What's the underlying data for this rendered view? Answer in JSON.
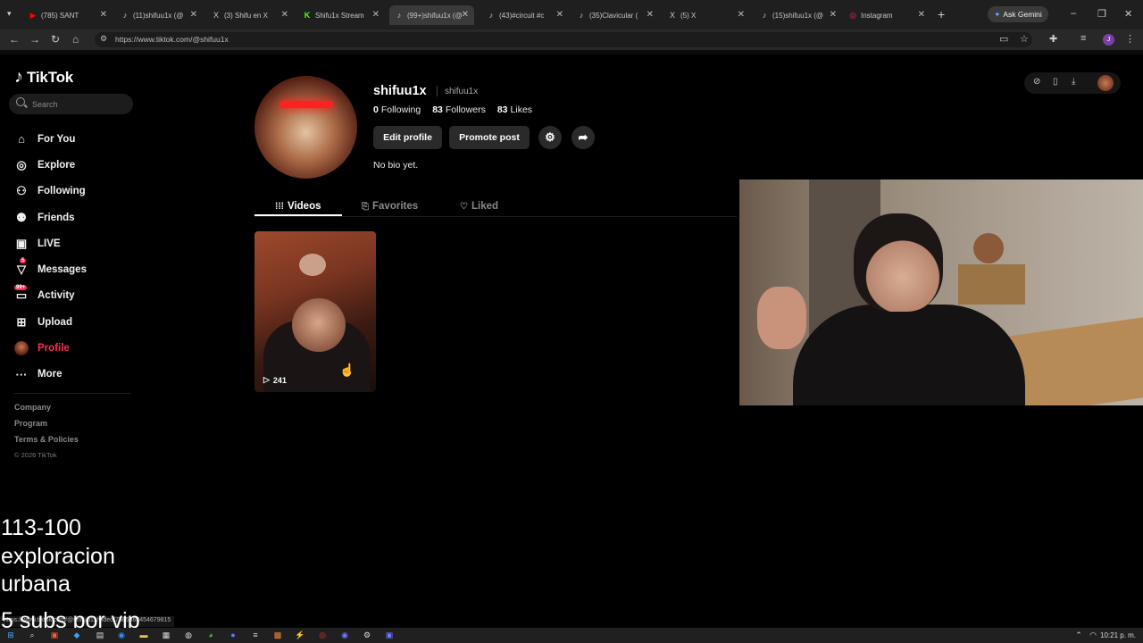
{
  "browser": {
    "tabs": [
      {
        "label": "(785) SANT",
        "icon": "youtube-icon",
        "color": "#ff0000"
      },
      {
        "label": "(11)shifuu1x (@",
        "icon": "tiktok-icon",
        "color": "#ffffff"
      },
      {
        "label": "(3) Shifu en X",
        "icon": "x-icon",
        "color": "#ffffff"
      },
      {
        "label": "Shifu1x Stream",
        "icon": "kick-icon",
        "color": "#53fc18"
      },
      {
        "label": "(99+)shifuu1x (@",
        "icon": "tiktok-icon",
        "color": "#ffffff",
        "active": true
      },
      {
        "label": "(43)#circuit #c",
        "icon": "tiktok-icon",
        "color": "#ffffff"
      },
      {
        "label": "(35)Clavicular (",
        "icon": "tiktok-icon",
        "color": "#ffffff"
      },
      {
        "label": "(5) X",
        "icon": "x-icon",
        "color": "#ffffff"
      },
      {
        "label": "(15)shifuu1x (@",
        "icon": "tiktok-icon",
        "color": "#ffffff"
      },
      {
        "label": "Instagram",
        "icon": "instagram-icon",
        "color": "#e1306c"
      }
    ],
    "ask_gemini": "Ask Gemini",
    "url": "https://www.tiktok.com/@shifuu1x",
    "profile_initial": "J"
  },
  "sidebar": {
    "logo_text": "TikTok",
    "search_placeholder": "Search",
    "items": [
      {
        "label": "For You",
        "icon": "home-icon"
      },
      {
        "label": "Explore",
        "icon": "compass-icon"
      },
      {
        "label": "Following",
        "icon": "following-icon"
      },
      {
        "label": "Friends",
        "icon": "friends-icon"
      },
      {
        "label": "LIVE",
        "icon": "live-icon"
      },
      {
        "label": "Messages",
        "icon": "messages-icon",
        "badge": "5"
      },
      {
        "label": "Activity",
        "icon": "activity-icon",
        "badge": "99+"
      },
      {
        "label": "Upload",
        "icon": "upload-icon"
      },
      {
        "label": "Profile",
        "icon": "profile-avatar",
        "active": true
      },
      {
        "label": "More",
        "icon": "more-icon"
      }
    ],
    "footer": {
      "company": "Company",
      "program": "Program",
      "terms": "Terms & Policies",
      "copyright": "© 2026 TikTok"
    }
  },
  "profile": {
    "username": "shifuu1x",
    "nickname": "shifuu1x",
    "following_count": "0",
    "following_label": "Following",
    "followers_count": "83",
    "followers_label": "Followers",
    "likes_count": "83",
    "likes_label": "Likes",
    "edit_profile": "Edit profile",
    "promote_post": "Promote post",
    "bio": "No bio yet.",
    "tabs": [
      {
        "label": "Videos",
        "active": true
      },
      {
        "label": "Favorites"
      },
      {
        "label": "Liked"
      }
    ],
    "videos": [
      {
        "views": "241"
      }
    ]
  },
  "overlay": {
    "line1": "113-100",
    "line2": "exploracion",
    "line3": "urbana",
    "line4": "5 subs por vip",
    "status_url": "https://www.tiktok.com/@shifuu1x/video/7585368454679815"
  },
  "taskbar": {
    "time": "10:21 p. m."
  }
}
